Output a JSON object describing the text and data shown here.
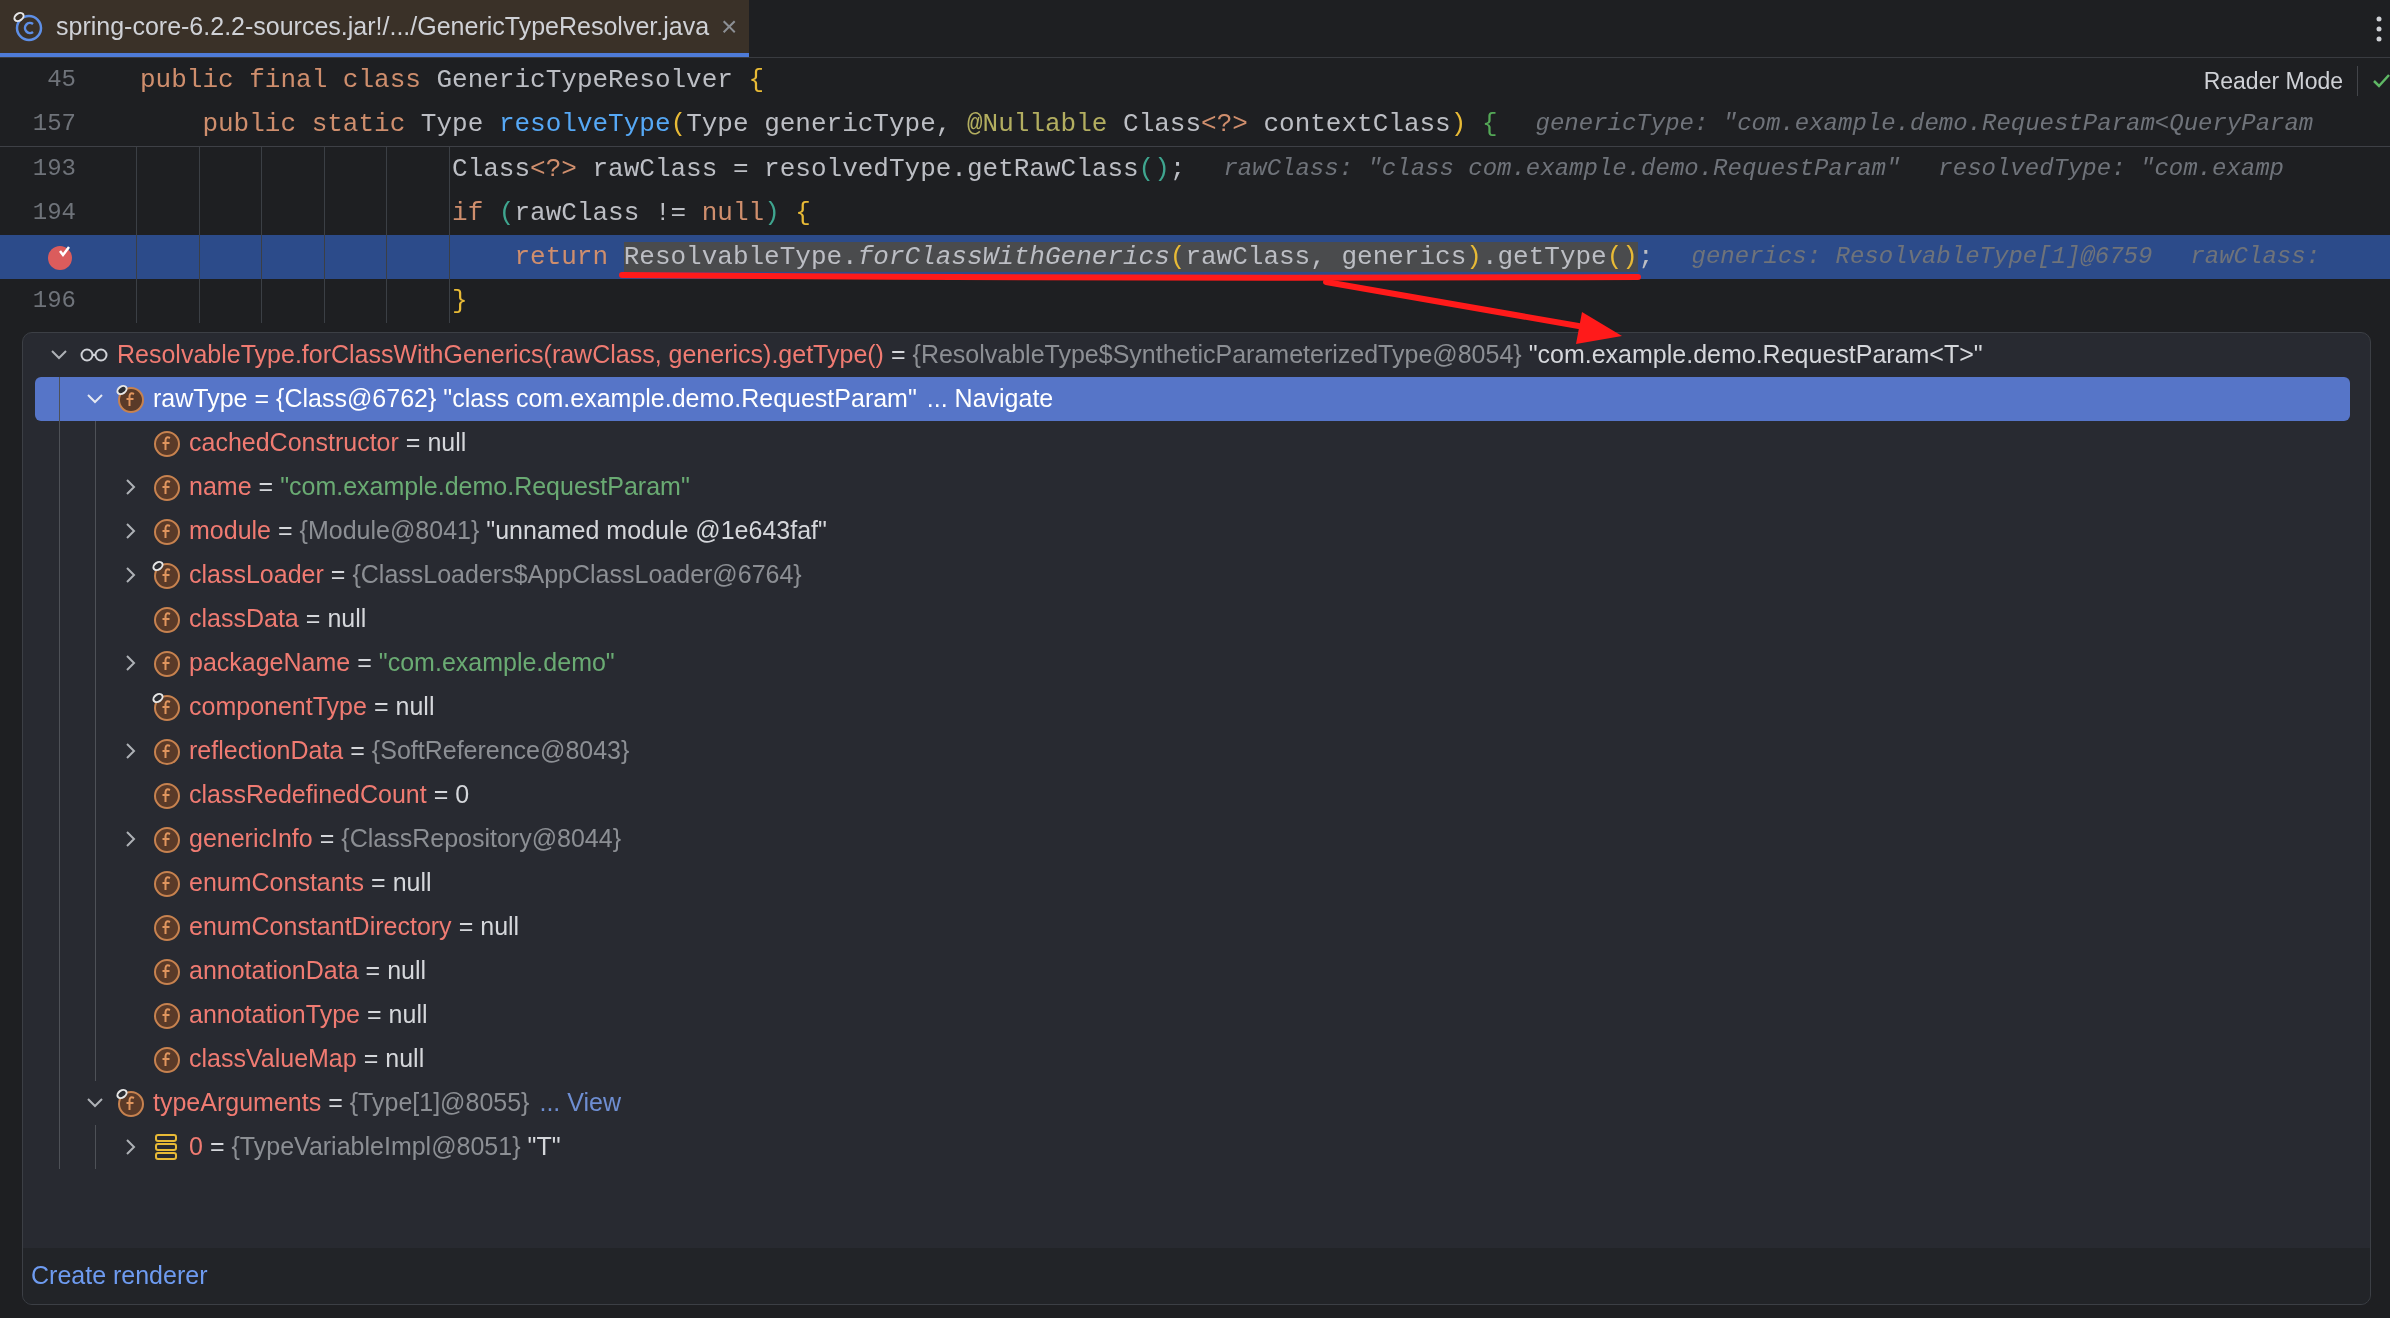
{
  "tab": {
    "title": "spring-core-6.2.2-sources.jar!/.../GenericTypeResolver.java",
    "close": "×",
    "selected": true
  },
  "editor": {
    "reader_mode": "Reader Mode",
    "sticky_lines": [
      {
        "number": "45",
        "tokens": [
          {
            "kind": "keyword",
            "s": "public final class "
          },
          {
            "kind": "plain",
            "s": "GenericTypeResolver "
          },
          {
            "kind": "bracket",
            "s": "{"
          }
        ]
      },
      {
        "number": "157",
        "tokens": [
          {
            "kind": "keyword",
            "s": "    public static "
          },
          {
            "kind": "plain",
            "s": "Type "
          },
          {
            "kind": "method",
            "s": "resolveType"
          },
          {
            "kind": "bracket",
            "s": "("
          },
          {
            "kind": "plain",
            "s": "Type genericType, "
          },
          {
            "kind": "annotation",
            "s": "@Nullable"
          },
          {
            "kind": "plain",
            "s": " Class"
          },
          {
            "kind": "keyword",
            "s": "<?>"
          },
          {
            "kind": "plain",
            "s": " contextClass"
          },
          {
            "kind": "bracket",
            "s": ")"
          },
          {
            "kind": "bracket_green",
            "s": " {"
          }
        ],
        "hints": [
          "genericType: \"com.example.demo.RequestParam<QueryParam"
        ]
      }
    ],
    "lines": [
      {
        "number": "193",
        "breakpoint": false,
        "current": false,
        "tokens": [
          {
            "kind": "plain",
            "s": "                    Class"
          },
          {
            "kind": "keyword",
            "s": "<?>"
          },
          {
            "kind": "plain",
            "s": " rawClass = resolvedType.getRawClass"
          },
          {
            "kind": "bracket_teal",
            "s": "()"
          },
          {
            "kind": "plain",
            "s": ";"
          }
        ],
        "hints": [
          "rawClass: \"class com.example.demo.RequestParam\"",
          "resolvedType: \"com.examp"
        ]
      },
      {
        "number": "194",
        "breakpoint": false,
        "current": false,
        "tokens": [
          {
            "kind": "keyword",
            "s": "                    if "
          },
          {
            "kind": "bracket_teal",
            "s": "("
          },
          {
            "kind": "plain",
            "s": "rawClass != "
          },
          {
            "kind": "keyword",
            "s": "null"
          },
          {
            "kind": "bracket_teal",
            "s": ")"
          },
          {
            "kind": "bracket",
            "s": " {"
          }
        ]
      },
      {
        "breakpoint": true,
        "current": true,
        "tokens": [
          {
            "kind": "keyword",
            "s": "                        return "
          }
        ],
        "highlighted": [
          {
            "kind": "plain",
            "s": "ResolvableType."
          },
          {
            "kind": "italic",
            "s": "forClassWithGenerics"
          },
          {
            "kind": "bracket",
            "s": "("
          },
          {
            "kind": "plain",
            "s": "rawClass, generics"
          },
          {
            "kind": "bracket",
            "s": ")"
          },
          {
            "kind": "plain",
            "s": ".getType"
          },
          {
            "kind": "bracket",
            "s": "()"
          }
        ],
        "tail": [
          {
            "kind": "plain",
            "s": ";"
          }
        ],
        "hints": [
          "generics: ResolvableType[1]@6759",
          "rawClass:"
        ]
      },
      {
        "number": "196",
        "breakpoint": false,
        "current": false,
        "tokens": [
          {
            "kind": "bracket",
            "s": "                    }"
          }
        ]
      }
    ]
  },
  "popup": {
    "tree": [
      {
        "expandable": true,
        "expanded": true,
        "kind": "watch",
        "selected": false,
        "name": "ResolvableType.forClassWithGenerics(rawClass, generics).getType()",
        "op": "=",
        "type": "{ResolvableType$SyntheticParameterizedType@8054}",
        "value": "\"com.example.demo.RequestParam<T>\"",
        "string_value": false,
        "children": [
          {
            "expandable": true,
            "expanded": true,
            "kind": "field_marked",
            "selected": true,
            "name": "rawType",
            "op": "=",
            "type": "{Class@6762}",
            "value": "\"class com.example.demo.RequestParam\"",
            "link": "... Navigate",
            "children": [
              {
                "expandable": false,
                "kind": "field",
                "selected": false,
                "name": "cachedConstructor",
                "op": "=",
                "value": "null",
                "string_value": false
              },
              {
                "expandable": true,
                "expanded": false,
                "kind": "field",
                "selected": false,
                "name": "name",
                "op": "=",
                "value": "\"com.example.demo.RequestParam\"",
                "string_value": true
              },
              {
                "expandable": true,
                "expanded": false,
                "kind": "field",
                "selected": false,
                "name": "module",
                "op": "=",
                "type": "{Module@8041}",
                "value": "\"unnamed module @1e643faf\"",
                "string_value": false
              },
              {
                "expandable": true,
                "expanded": false,
                "kind": "field_marked",
                "selected": false,
                "name": "classLoader",
                "op": "=",
                "type": "{ClassLoaders$AppClassLoader@6764}"
              },
              {
                "expandable": false,
                "kind": "field",
                "selected": false,
                "name": "classData",
                "op": "=",
                "value": "null",
                "string_value": false
              },
              {
                "expandable": true,
                "expanded": false,
                "kind": "field",
                "selected": false,
                "name": "packageName",
                "op": "=",
                "value": "\"com.example.demo\"",
                "string_value": true
              },
              {
                "expandable": false,
                "kind": "field_marked",
                "selected": false,
                "name": "componentType",
                "op": "=",
                "value": "null",
                "string_value": false
              },
              {
                "expandable": true,
                "expanded": false,
                "kind": "field",
                "selected": false,
                "name": "reflectionData",
                "op": "=",
                "type": "{SoftReference@8043}"
              },
              {
                "expandable": false,
                "kind": "field",
                "selected": false,
                "name": "classRedefinedCount",
                "op": "=",
                "value": "0",
                "string_value": false
              },
              {
                "expandable": true,
                "expanded": false,
                "kind": "field",
                "selected": false,
                "name": "genericInfo",
                "op": "=",
                "type": "{ClassRepository@8044}"
              },
              {
                "expandable": false,
                "kind": "field",
                "selected": false,
                "name": "enumConstants",
                "op": "=",
                "value": "null",
                "string_value": false
              },
              {
                "expandable": false,
                "kind": "field",
                "selected": false,
                "name": "enumConstantDirectory",
                "op": "=",
                "value": "null",
                "string_value": false
              },
              {
                "expandable": false,
                "kind": "field",
                "selected": false,
                "name": "annotationData",
                "op": "=",
                "value": "null",
                "string_value": false
              },
              {
                "expandable": false,
                "kind": "field",
                "selected": false,
                "name": "annotationType",
                "op": "=",
                "value": "null",
                "string_value": false
              },
              {
                "expandable": false,
                "kind": "field",
                "selected": false,
                "name": "classValueMap",
                "op": "=",
                "value": "null",
                "string_value": false
              }
            ]
          },
          {
            "expandable": true,
            "expanded": true,
            "kind": "field_marked",
            "selected": false,
            "name": "typeArguments",
            "op": "=",
            "type": "{Type[1]@8055}",
            "link": "... View",
            "children": [
              {
                "expandable": true,
                "expanded": false,
                "kind": "array",
                "selected": false,
                "name": "0",
                "op": "=",
                "type": "{TypeVariableImpl@8051}",
                "value": "\"T\"",
                "string_value": false
              }
            ]
          }
        ]
      }
    ],
    "footer_link": "Create renderer"
  }
}
